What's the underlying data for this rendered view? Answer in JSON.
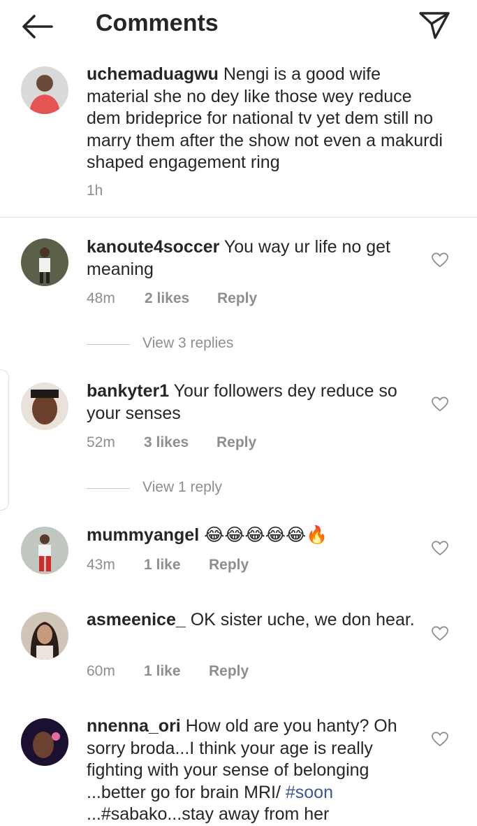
{
  "header": {
    "title": "Comments",
    "back_icon": "arrow-left-icon",
    "share_icon": "paper-plane-icon"
  },
  "caption": {
    "username": "uchemaduagwu",
    "text": "Nengi is a good wife material she no dey like those wey reduce dem brideprice for national tv yet dem still no marry them after the show not even a makurdi shaped engagement ring",
    "time": "1h"
  },
  "comments": [
    {
      "username": "kanoute4soccer",
      "text": "You way ur life no get meaning",
      "time": "48m",
      "likes": "2 likes",
      "reply": "Reply",
      "view_replies": "View 3 replies"
    },
    {
      "username": "bankyter1",
      "text": "Your followers dey reduce so your senses",
      "time": "52m",
      "likes": "3 likes",
      "reply": "Reply",
      "view_replies": "View 1 reply"
    },
    {
      "username": "mummyangel",
      "text": "😂😂😂😂😂🔥",
      "time": "43m",
      "likes": "1 like",
      "reply": "Reply"
    },
    {
      "username": "asmeenice_",
      "text": "OK sister uche, we don hear.",
      "time": "60m",
      "likes": "1 like",
      "reply": "Reply"
    },
    {
      "username": "nnenna_ori",
      "text": "How old are you hanty? Oh sorry broda...I think your age is really fighting with your sense of belonging ...better go for brain MRI/",
      "hashtag": "#soon",
      "text_tail": "...#sabako...stay away from her"
    }
  ],
  "colors": {
    "text": "#262626",
    "secondary": "#8e8e8e",
    "divider": "#dbdbdb",
    "link": "#385898"
  }
}
